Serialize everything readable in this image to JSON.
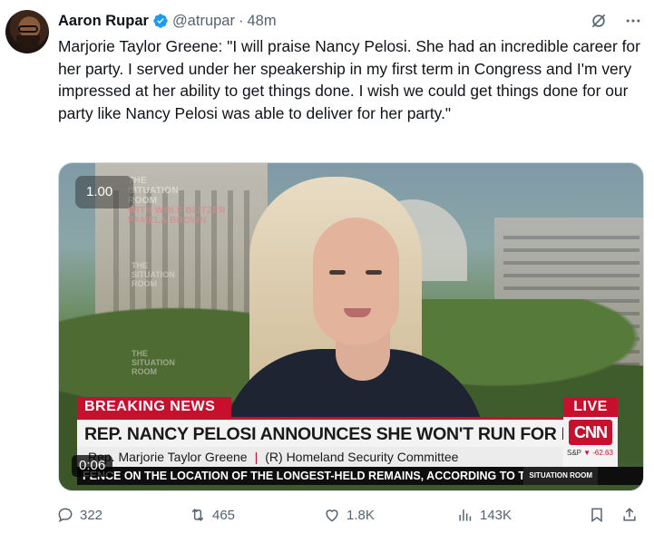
{
  "author": {
    "name": "Aaron Rupar",
    "handle": "@atrupar",
    "separator": "·",
    "time": "48m"
  },
  "icons": {
    "verified": "verified-badge-icon",
    "grok": "grok-icon",
    "more": "more-icon",
    "reply": "reply-icon",
    "repost": "repost-icon",
    "like": "like-icon",
    "views": "views-icon",
    "bookmark": "bookmark-icon",
    "share": "share-icon"
  },
  "colors": {
    "verified": "#1d9bf0",
    "muted": "#536471",
    "cnn_red": "#c8102e"
  },
  "tweet_text": "Marjorie Taylor Greene: \"I will praise Nancy Pelosi. She had an incredible career for her party. I served under her speakership in my first term in Congress and I'm very impressed at her ability to get things done. I wish we could get things done for our party like Nancy Pelosi was able to deliver for her party.\"",
  "media": {
    "speed": "1.00",
    "elapsed": "0:06",
    "show_logo_line1": "THE",
    "show_logo_line2": "SITUATION",
    "show_logo_line3": "ROOM",
    "show_logo_hosts1": "WITH WOLF BLITZER",
    "show_logo_hosts2": "PAMELA BROWN",
    "breaking": "BREAKING NEWS",
    "live": "LIVE",
    "headline": "REP. NANCY PELOSI ANNOUNCES SHE WON'T RUN FOR REELECTION",
    "subline_name": "Rep. Marjorie Taylor Greene",
    "subline_sep": "|",
    "subline_role": "(R) Homeland Security Committee",
    "network": "CNN",
    "ticker_label": "S&P",
    "ticker_value": "▼ -62.63",
    "crawl": "FENCE ON THE LOCATION OF THE LONGEST-HELD REMAINS, ACCORDING TO TWO ISR",
    "crawl_tag": "SITUATION ROOM"
  },
  "actions": {
    "replies": "322",
    "reposts": "465",
    "likes": "1.8K",
    "views": "143K"
  }
}
